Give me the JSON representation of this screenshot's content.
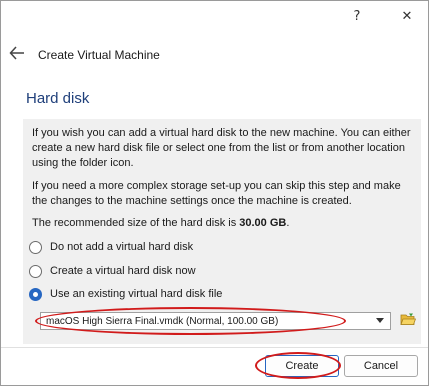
{
  "titlebar": {
    "help_label": "?",
    "close_label": "✕"
  },
  "header": {
    "title": "Create Virtual Machine",
    "back_icon": "arrow-left-icon"
  },
  "page": {
    "title": "Hard disk"
  },
  "content": {
    "para1": "If you wish you can add a virtual hard disk to the new machine. You can either create a new hard disk file or select one from the list or from another location using the folder icon.",
    "para2": "If you need a more complex storage set-up you can skip this step and make the changes to the machine settings once the machine is created.",
    "para3_prefix": "The recommended size of the hard disk is ",
    "para3_value": "30.00 GB",
    "para3_suffix": "."
  },
  "options": [
    {
      "label": "Do not add a virtual hard disk",
      "checked": false
    },
    {
      "label": "Create a virtual hard disk now",
      "checked": false
    },
    {
      "label": "Use an existing virtual hard disk file",
      "checked": true
    }
  ],
  "disk_select": {
    "value": "macOS High Sierra Final.vmdk (Normal, 100.00 GB)",
    "folder_icon": "folder-open-icon"
  },
  "buttons": {
    "create": "Create",
    "cancel": "Cancel"
  },
  "colors": {
    "accent": "#2767c2",
    "annotation": "#d11b1b",
    "title_blue": "#1f3f7a"
  }
}
